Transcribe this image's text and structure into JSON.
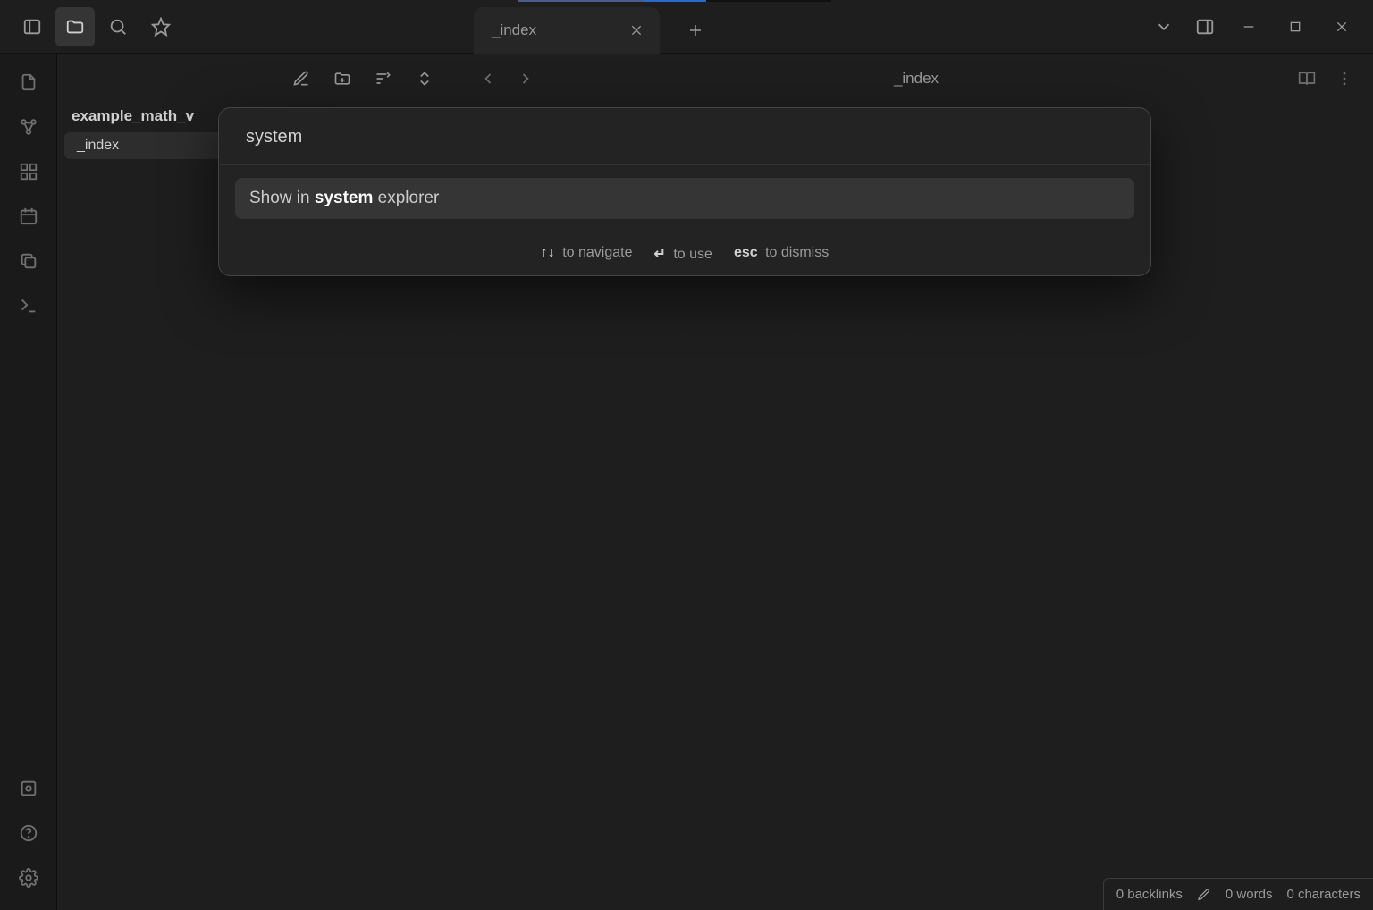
{
  "tabs": [
    {
      "label": "_index"
    }
  ],
  "editor": {
    "title": "_index"
  },
  "sidebar": {
    "vault_name": "example_math_v",
    "files": [
      {
        "name": "_index",
        "active": true
      }
    ]
  },
  "palette": {
    "query": "system",
    "result_prefix": "Show in ",
    "result_match": "system",
    "result_suffix": " explorer",
    "hints": {
      "nav_key": "↑↓",
      "nav_text": "to navigate",
      "use_key": "↵",
      "use_text": "to use",
      "dismiss_key": "esc",
      "dismiss_text": "to dismiss"
    }
  },
  "status": {
    "backlinks": "0 backlinks",
    "words": "0 words",
    "characters": "0 characters"
  }
}
